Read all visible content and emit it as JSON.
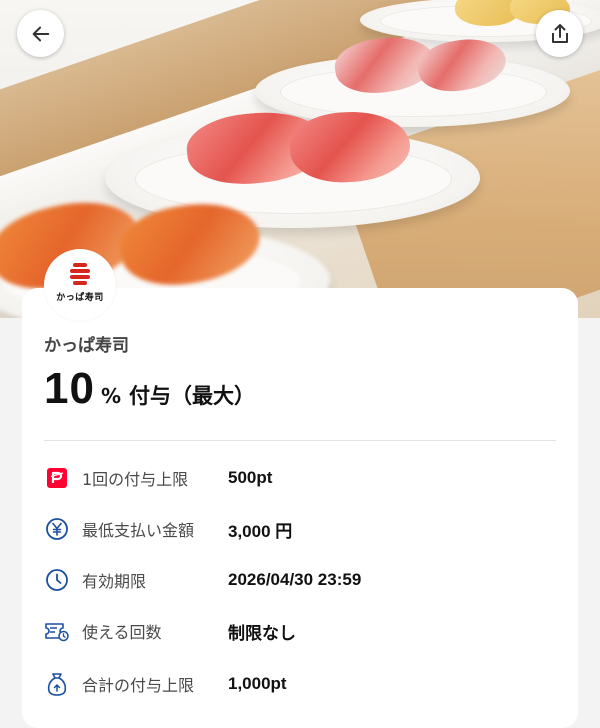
{
  "header": {
    "back_icon": "arrow-left-icon",
    "share_icon": "share-icon"
  },
  "hero": {
    "description_icon": "sushi-conveyor-photo"
  },
  "store": {
    "logo_text": "かっぱ寿司",
    "name": "かっぱ寿司"
  },
  "reward": {
    "rate": "10",
    "unit": "%",
    "text": "付与（最大）"
  },
  "details": [
    {
      "icon": "paypay-icon",
      "label": "1回の付与上限",
      "value": "500pt"
    },
    {
      "icon": "yen-circle-icon",
      "label": "最低支払い金額",
      "value": "3,000 円"
    },
    {
      "icon": "clock-icon",
      "label": "有効期限",
      "value": "2026/04/30 23:59"
    },
    {
      "icon": "ticket-icon",
      "label": "使える回数",
      "value": "制限なし"
    },
    {
      "icon": "money-bag-icon",
      "label": "合計の付与上限",
      "value": "1,000pt"
    }
  ],
  "colors": {
    "brand_red": "#d7261e",
    "paypay_red": "#ff0033",
    "icon_blue": "#1b4fa0"
  }
}
